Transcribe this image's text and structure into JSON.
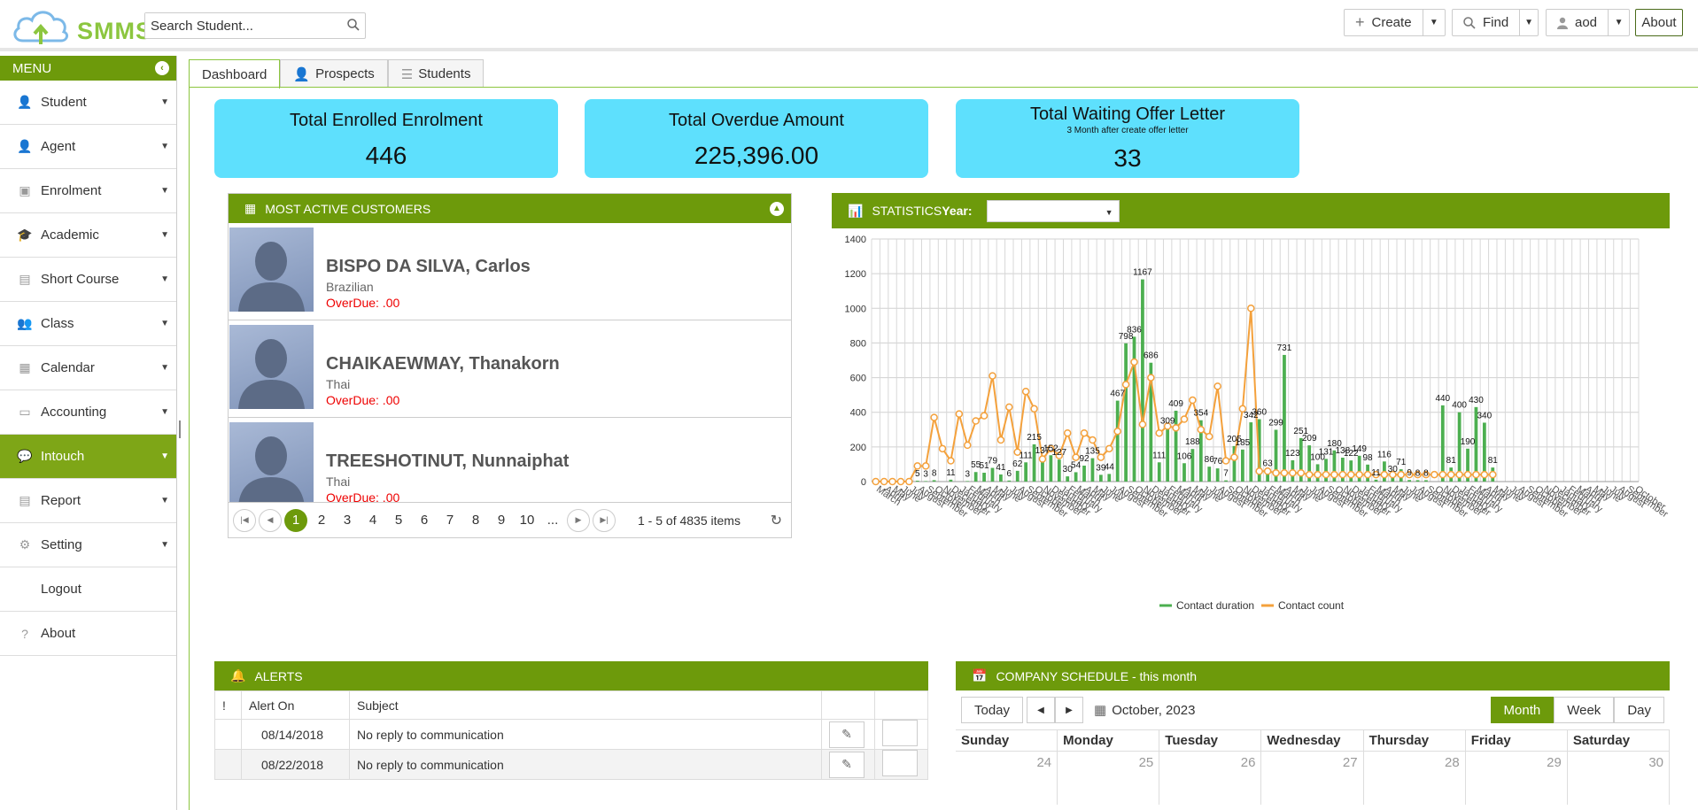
{
  "app": {
    "name": "SMMS"
  },
  "search": {
    "placeholder": "Search Student..."
  },
  "toolbar": {
    "create_label": "Create",
    "find_label": "Find",
    "user_label": "aod",
    "about_label": "About"
  },
  "sidebar": {
    "header": "MENU",
    "items": [
      {
        "label": "Student",
        "icon": "user-icon",
        "expandable": true
      },
      {
        "label": "Agent",
        "icon": "user-icon",
        "expandable": true
      },
      {
        "label": "Enrolment",
        "icon": "enrolment-icon",
        "expandable": true
      },
      {
        "label": "Academic",
        "icon": "graduation-cap-icon",
        "expandable": true
      },
      {
        "label": "Short Course",
        "icon": "document-icon",
        "expandable": true
      },
      {
        "label": "Class",
        "icon": "users-icon",
        "expandable": true
      },
      {
        "label": "Calendar",
        "icon": "calendar-icon",
        "expandable": true
      },
      {
        "label": "Accounting",
        "icon": "id-card-icon",
        "expandable": true
      },
      {
        "label": "Intouch",
        "icon": "chat-icon",
        "expandable": true,
        "active": true
      },
      {
        "label": "Report",
        "icon": "report-icon",
        "expandable": true
      },
      {
        "label": "Setting",
        "icon": "gears-icon",
        "expandable": true
      },
      {
        "label": "Logout",
        "icon": "",
        "expandable": false
      },
      {
        "label": "About",
        "icon": "question-icon",
        "expandable": false
      }
    ]
  },
  "tabs": [
    {
      "label": "Dashboard",
      "active": true
    },
    {
      "label": "Prospects",
      "icon": "user-icon"
    },
    {
      "label": "Students",
      "icon": "list-icon"
    }
  ],
  "cards": [
    {
      "title": "Total Enrolled Enrolment",
      "value": "446"
    },
    {
      "title": "Total Overdue Amount",
      "value": "225,396.00"
    },
    {
      "title": "Total Waiting Offer Letter",
      "subtitle": "3 Month after create offer letter",
      "value": "33"
    }
  ],
  "customers": {
    "title": "MOST ACTIVE CUSTOMERS",
    "rows": [
      {
        "name": "BISPO DA SILVA, Carlos",
        "nationality": "Brazilian",
        "overdue": "OverDue: .00"
      },
      {
        "name": "CHAIKAEWMAY, Thanakorn",
        "nationality": "Thai",
        "overdue": "OverDue: .00"
      },
      {
        "name": "TREESHOTINUT, Nunnaiphat",
        "nationality": "Thai",
        "overdue": "OverDue: .00"
      }
    ],
    "pager": {
      "pages": [
        "1",
        "2",
        "3",
        "4",
        "5",
        "6",
        "7",
        "8",
        "9",
        "10",
        "..."
      ],
      "current": "1",
      "info": "1 - 5 of 4835 items"
    }
  },
  "statistics": {
    "title": "STATISTICS",
    "year_label": "Year:",
    "year_value": ""
  },
  "chart_data": {
    "type": "bar",
    "ylim": [
      0,
      1400
    ],
    "yticks": [
      0,
      200,
      400,
      600,
      800,
      1000,
      1200,
      1400
    ],
    "grid": true,
    "legend_position": "bottom",
    "categories": [
      "March",
      "April",
      "May",
      "June",
      "July",
      "August",
      "September",
      "October",
      "November",
      "December",
      "January",
      "February",
      "March",
      "April",
      "May",
      "June",
      "July",
      "August",
      "September",
      "October",
      "November",
      "December",
      "January",
      "February",
      "March",
      "April",
      "May",
      "June",
      "July",
      "August",
      "September",
      "October",
      "November",
      "December",
      "January",
      "February",
      "March",
      "April",
      "May",
      "June",
      "July",
      "August",
      "September",
      "October",
      "November",
      "December",
      "January",
      "February",
      "March",
      "April",
      "May",
      "June",
      "July",
      "August",
      "September",
      "October",
      "November",
      "December",
      "January",
      "February",
      "March",
      "April",
      "May",
      "June",
      "July",
      "August",
      "September",
      "October",
      "November",
      "December",
      "January",
      "February",
      "March",
      "April",
      "May",
      "June",
      "July",
      "August",
      "September",
      "October",
      "November",
      "December",
      "January",
      "February",
      "March",
      "April",
      "May",
      "June",
      "July",
      "August",
      "September",
      "October"
    ],
    "series": [
      {
        "name": "Contact duration",
        "color": "#4caf50",
        "type": "bar",
        "values": [
          0,
          0,
          0,
          0,
          0,
          5,
          3,
          8,
          0,
          11,
          0,
          3,
          55,
          51,
          79,
          41,
          6,
          62,
          111,
          215,
          137,
          152,
          127,
          30,
          54,
          92,
          135,
          39,
          44,
          467,
          798,
          836,
          1167,
          686,
          111,
          309,
          409,
          106,
          188,
          354,
          86,
          76,
          7,
          205,
          185,
          342,
          360,
          63,
          299,
          731,
          123,
          251,
          209,
          100,
          131,
          180,
          138,
          122,
          149,
          98,
          11,
          116,
          30,
          71,
          9,
          8,
          8,
          0,
          440,
          81,
          400,
          190,
          430,
          340,
          81
        ]
      },
      {
        "name": "Contact count",
        "color": "#f4a13c",
        "type": "line",
        "values": [
          0,
          0,
          0,
          0,
          0,
          90,
          90,
          370,
          190,
          120,
          390,
          210,
          350,
          380,
          610,
          240,
          430,
          170,
          520,
          420,
          130,
          190,
          150,
          280,
          140,
          280,
          240,
          140,
          190,
          290,
          560,
          690,
          330,
          600,
          280,
          320,
          310,
          360,
          470,
          300,
          260,
          550,
          120,
          140,
          420,
          1000,
          60,
          60,
          50,
          50,
          50,
          50,
          40,
          40,
          40,
          40,
          40,
          40,
          40,
          40,
          40,
          40,
          40,
          40,
          40,
          40,
          40,
          40,
          40,
          40,
          40,
          40,
          40,
          40,
          40
        ]
      }
    ]
  },
  "alerts": {
    "title": "ALERTS",
    "columns": [
      "!",
      "Alert On",
      "Subject"
    ],
    "rows": [
      {
        "date": "08/14/2018",
        "subject": "No reply to communication"
      },
      {
        "date": "08/22/2018",
        "subject": "No reply to communication"
      }
    ]
  },
  "schedule": {
    "title": "COMPANY SCHEDULE - this month",
    "today_label": "Today",
    "period": "October, 2023",
    "views": [
      "Month",
      "Week",
      "Day"
    ],
    "active_view": "Month",
    "weekdays": [
      "Sunday",
      "Monday",
      "Tuesday",
      "Wednesday",
      "Thursday",
      "Friday",
      "Saturday"
    ],
    "first_row_days": [
      "24",
      "25",
      "26",
      "27",
      "28",
      "29",
      "30"
    ]
  }
}
